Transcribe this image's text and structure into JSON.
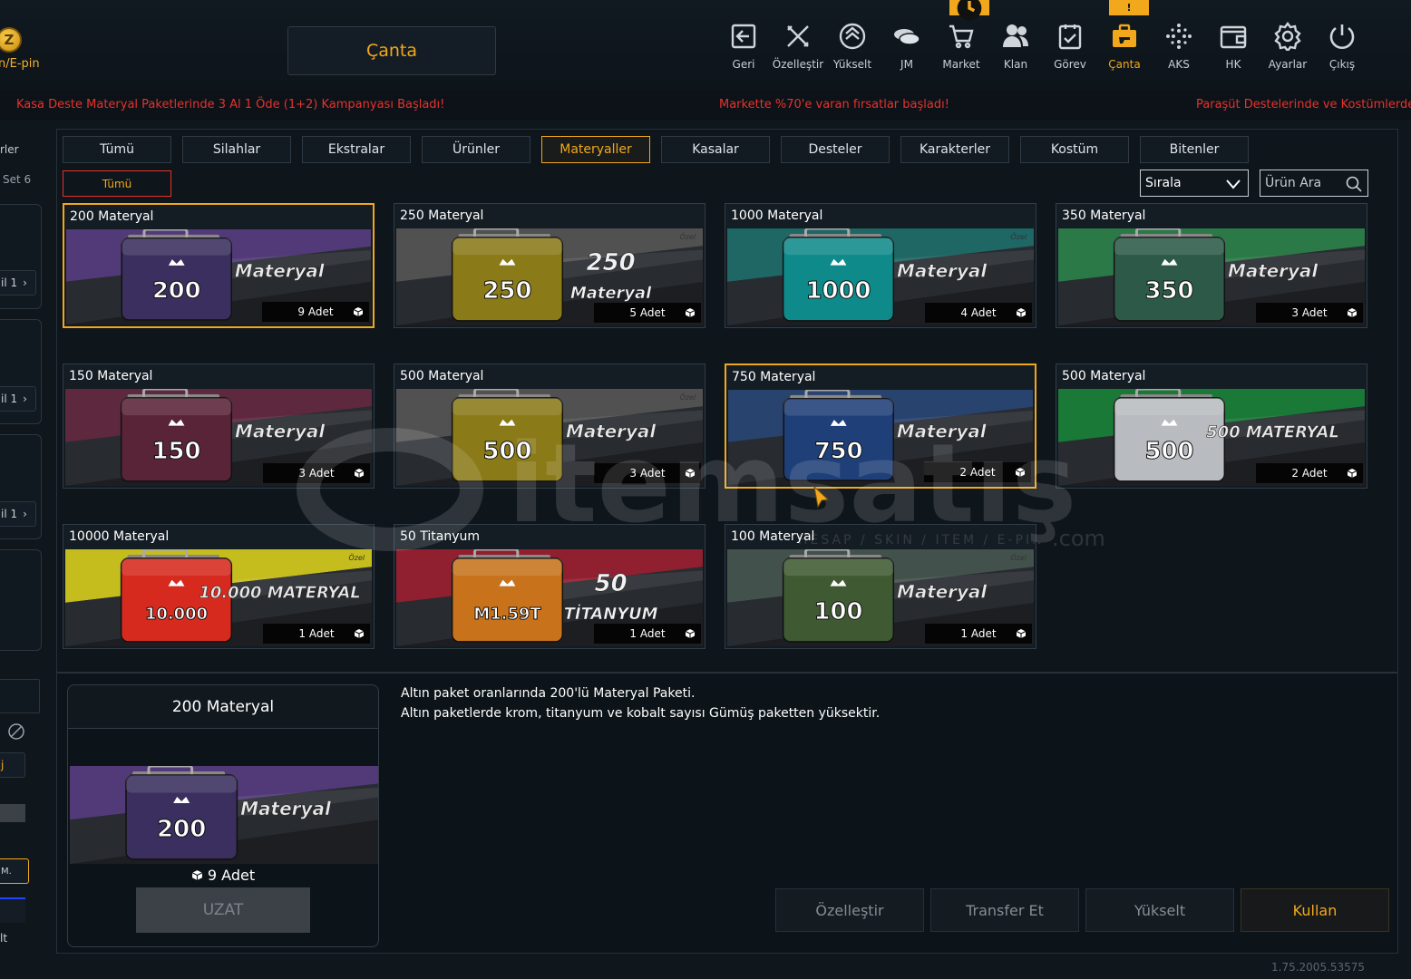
{
  "topbar": {
    "coin_symbol": "Z",
    "coin_label": "n/E-pin",
    "title": "Çanta"
  },
  "nav": [
    {
      "label": "Geri",
      "icon": "back-icon"
    },
    {
      "label": "Özelleştir",
      "icon": "tools-icon"
    },
    {
      "label": "Yükselt",
      "icon": "upgrade-icon"
    },
    {
      "label": "JM",
      "icon": "coins-icon"
    },
    {
      "label": "Market",
      "icon": "cart-icon"
    },
    {
      "label": "Klan",
      "icon": "clan-icon"
    },
    {
      "label": "Görev",
      "icon": "mission-icon",
      "badge": "clock"
    },
    {
      "label": "Çanta",
      "icon": "bag-icon",
      "badge": "!"
    },
    {
      "label": "AKS",
      "icon": "aks-icon"
    },
    {
      "label": "HK",
      "icon": "wallet-icon"
    },
    {
      "label": "Ayarlar",
      "icon": "gear-icon"
    },
    {
      "label": "Çıkış",
      "icon": "power-icon"
    }
  ],
  "ticker": [
    "Kasa Deste Materyal Paketlerinde 3 Al 1 Öde (1+2) Kampanyası Başladı!",
    "Markette %70'e varan fırsatlar başladı!",
    "Paraşüt Destelerinde ve Kostümlerde"
  ],
  "rail": {
    "text1": "rler",
    "text2": "Set 6",
    "item1": "il 1",
    "item2": "il 1",
    "item3": "il 1",
    "chip1": "j",
    "chip2": "M.",
    "text3": "lt"
  },
  "tabs": [
    "Tümü",
    "Silahlar",
    "Ekstralar",
    "Ürünler",
    "Materyaller",
    "Kasalar",
    "Desteler",
    "Karakterler",
    "Kostüm",
    "Bitenler"
  ],
  "active_tab": "Materyaller",
  "subtab": "Tümü",
  "sort_label": "Sırala",
  "search_placeholder": "Ürün Ara",
  "items": [
    {
      "title": "200 Materyal",
      "count": "9 Adet",
      "badge": "200",
      "art_text": "Materyal",
      "art_text2": "",
      "special": "",
      "case_color": "#3a2f5e",
      "bg": "#5b3f86",
      "selected": true
    },
    {
      "title": "250 Materyal",
      "count": "5 Adet",
      "badge": "250",
      "art_text": "250",
      "art_text2": "Materyal",
      "special": "Özel",
      "case_color": "#8a7a18",
      "bg": "#5a5a5a",
      "selected": false
    },
    {
      "title": "1000 Materyal",
      "count": "4 Adet",
      "badge": "1000",
      "art_text": "Materyal",
      "art_text2": "",
      "special": "Özel",
      "case_color": "#0f8a8a",
      "bg": "#1f7470",
      "selected": false
    },
    {
      "title": "350 Materyal",
      "count": "3 Adet",
      "badge": "350",
      "art_text": "Materyal",
      "art_text2": "",
      "special": "",
      "case_color": "#2d5a48",
      "bg": "#2f8a4f",
      "selected": false
    },
    {
      "title": "150 Materyal",
      "count": "3 Adet",
      "badge": "150",
      "art_text": "Materyal",
      "art_text2": "",
      "special": "",
      "case_color": "#5a2438",
      "bg": "#6a2a44",
      "selected": false
    },
    {
      "title": "500 Materyal",
      "count": "3 Adet",
      "badge": "500",
      "art_text": "Materyal",
      "art_text2": "",
      "special": "Özel",
      "case_color": "#8a7a18",
      "bg": "#5a5a5a",
      "selected": false
    },
    {
      "title": "750 Materyal",
      "count": "2 Adet",
      "badge": "750",
      "art_text": "Materyal",
      "art_text2": "",
      "special": "",
      "case_color": "#1f3f78",
      "bg": "#2c4a7c",
      "selected": true
    },
    {
      "title": "500 Materyal",
      "count": "2 Adet",
      "badge": "500",
      "art_text": "500 MATERYAL",
      "art_text2": "",
      "special": "",
      "case_color": "#b8bcc0",
      "bg": "#1a8a3a",
      "selected": false
    },
    {
      "title": "10000 Materyal",
      "count": "1 Adet",
      "badge": "10.000",
      "art_text": "10.000 MATERYAL",
      "art_text2": "",
      "special": "Özel",
      "case_color": "#d62a1e",
      "bg": "#e3d81c",
      "selected": false
    },
    {
      "title": "50 Titanyum",
      "count": "1 Adet",
      "badge": "M1.59T",
      "art_text": "50",
      "art_text2": "TİTANYUM",
      "special": "",
      "case_color": "#c8731c",
      "bg": "#a52032",
      "selected": false
    },
    {
      "title": "100 Materyal",
      "count": "1 Adet",
      "badge": "100",
      "art_text": "Materyal",
      "art_text2": "",
      "special": "Özel",
      "case_color": "#3f5a32",
      "bg": "#4a5a54",
      "selected": false
    }
  ],
  "detail": {
    "title": "200 Materyal",
    "count": "9 Adet",
    "badge": "200",
    "art_text": "Materyal",
    "button": "UZAT",
    "description_line1": "Altın paket oranlarında 200'lü Materyal Paketi.",
    "description_line2": "Altın paketlerde krom, titanyum ve kobalt sayısı Gümüş paketten yüksektir."
  },
  "actions": [
    "Özelleştir",
    "Transfer Et",
    "Yükselt",
    "Kullan"
  ],
  "version": "1.75.2005.53575",
  "watermark": {
    "brand": "itemsatış",
    "tagline": "HESAP / SKIN / ITEM / E-PIN",
    "domain": ".com"
  }
}
